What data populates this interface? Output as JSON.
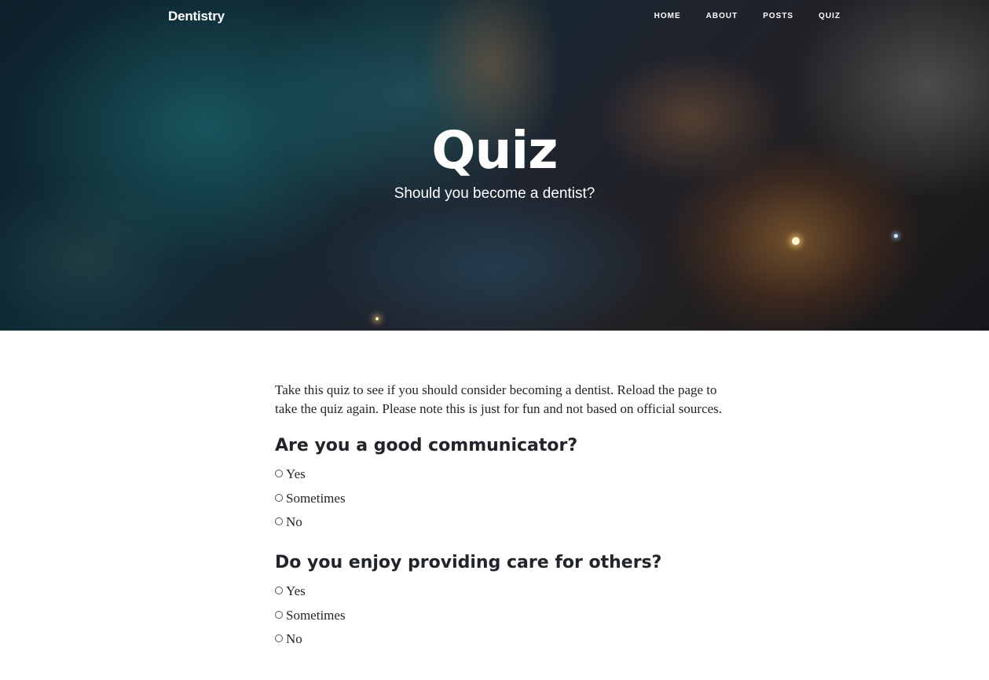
{
  "nav": {
    "brand": "Dentistry",
    "links": [
      "HOME",
      "ABOUT",
      "POSTS",
      "QUIZ"
    ]
  },
  "hero": {
    "title": "Quiz",
    "subtitle": "Should you become a dentist?"
  },
  "intro": "Take this quiz to see if you should consider becoming a dentist. Reload the page to take the quiz again. Please note this is just for fun and not based on official sources.",
  "questions": [
    {
      "title": "Are you a good communicator?",
      "options": [
        "Yes",
        "Sometimes",
        "No"
      ]
    },
    {
      "title": "Do you enjoy providing care for others?",
      "options": [
        "Yes",
        "Sometimes",
        "No"
      ]
    }
  ]
}
